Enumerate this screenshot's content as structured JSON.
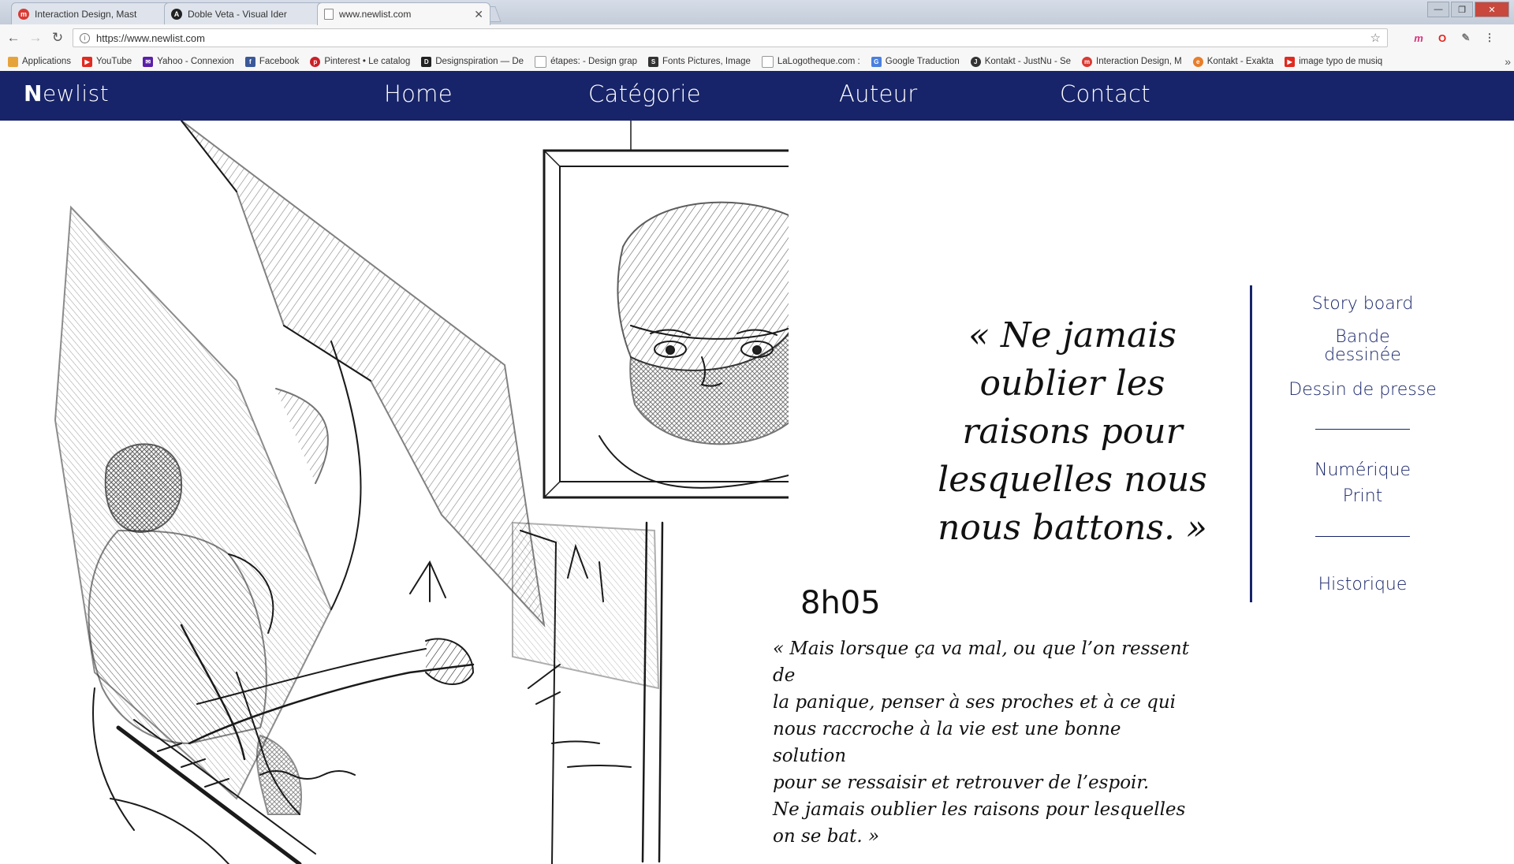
{
  "browser": {
    "tabs": [
      {
        "title": "Interaction Design, Mast",
        "fav_color": "#d93a33",
        "fav_glyph": "m"
      },
      {
        "title": "Doble Veta - Visual Ider",
        "fav_color": "#222222",
        "fav_glyph": "A"
      },
      {
        "title": "www.newlist.com",
        "fav_color": "#ffffff",
        "fav_glyph": ""
      }
    ],
    "url": "https://www.newlist.com",
    "bookmarks": [
      {
        "label": "Applications",
        "color": "#e7a33b"
      },
      {
        "label": "YouTube",
        "color": "#e02a20"
      },
      {
        "label": "Yahoo - Connexion",
        "color": "#5a1fa8"
      },
      {
        "label": "Facebook",
        "color": "#3b5998"
      },
      {
        "label": "Pinterest • Le catalog",
        "color": "#cb1f27"
      },
      {
        "label": "Designspiration — De",
        "color": "#222222"
      },
      {
        "label": "étapes: - Design grap",
        "color": "#bbbbbb"
      },
      {
        "label": "Fonts Pictures, Image",
        "color": "#333333"
      },
      {
        "label": "LaLogotheque.com :",
        "color": "#bbbbbb"
      },
      {
        "label": "Google Traduction",
        "color": "#4a7fe0"
      },
      {
        "label": "Kontakt - JustNu - Se",
        "color": "#333333"
      },
      {
        "label": "Interaction Design, M",
        "color": "#d93a33"
      },
      {
        "label": "Kontakt - Exakta",
        "color": "#e87d2a"
      },
      {
        "label": "image typo de musiq",
        "color": "#e02a20"
      }
    ]
  },
  "site": {
    "logo_first": "N",
    "logo_rest": "ewlist",
    "nav": [
      "Home",
      "Catégorie",
      "Auteur",
      "Contact"
    ],
    "nav_color": "#172469"
  },
  "content": {
    "quote_big": "« Ne jamais oublier les raisons pour lesquelles nous nous battons. »",
    "time": "8h05",
    "quote_small": [
      "« Mais lorsque ça va mal, ou que l’on ressent de",
      "la panique, penser à ses proches et à ce qui",
      "nous raccroche à la vie est une bonne solution",
      "pour se ressaisir et retrouver de l’espoir.",
      "Ne jamais oublier les raisons pour lesquelles",
      "on se bat. »"
    ]
  },
  "sidebar": {
    "group1": [
      "Story board",
      "Bande dessinée",
      "Dessin de presse"
    ],
    "group2": [
      "Numérique",
      "Print"
    ],
    "group3": [
      "Historique"
    ]
  }
}
